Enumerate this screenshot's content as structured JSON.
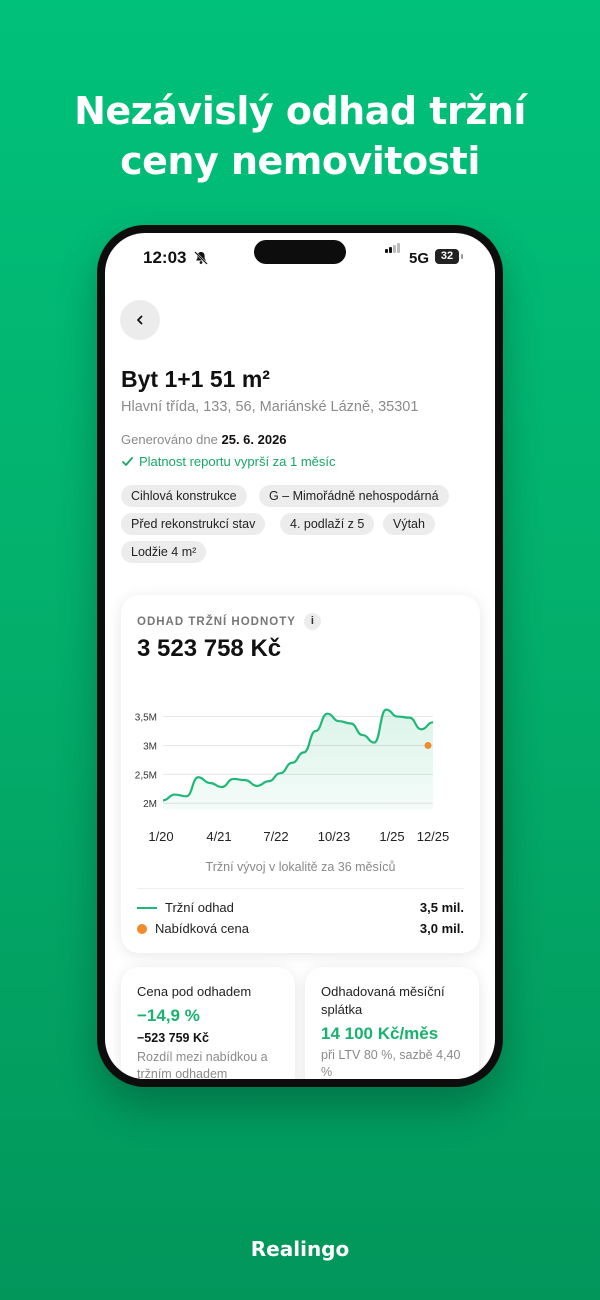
{
  "headline": {
    "line1": "Nezávislý odhad tržní",
    "line2": "ceny nemovitosti"
  },
  "status_bar": {
    "time": "12:03",
    "network": "5G",
    "battery": "32"
  },
  "property": {
    "title": "Byt 1+1 51 m²",
    "address": "Hlavní třída, 133, 56, Mariánské Lázně, 35301",
    "generated_label": "Generováno dne",
    "generated_date": "25. 6. 2026",
    "validity": "Platnost reportu vyprší za 1 měsíc"
  },
  "chips": [
    "Cihlová konstrukce",
    "G – Mimořádně nehospodárná",
    "Před rekonstrukcí stav",
    "4. podlaží z 5",
    "Výtah",
    "Lodžie 4 m²"
  ],
  "estimate_card": {
    "label": "ODHAD TRŽNÍ HODNOTY",
    "info": "i",
    "value": "3 523 758 Kč",
    "caption": "Tržní vývoj v lokalitě za 36 měsíců",
    "legend": [
      {
        "label": "Tržní odhad",
        "value": "3,5 mil."
      },
      {
        "label": "Nabídková cena",
        "value": "3,0 mil."
      }
    ]
  },
  "chart_data": {
    "type": "line",
    "x_ticks": [
      "1/20",
      "4/21",
      "7/22",
      "10/23",
      "1/25",
      "12/25"
    ],
    "y_ticks": [
      "2M",
      "2,5M",
      "3M",
      "3,5M"
    ],
    "ylim": [
      2.0,
      3.5
    ],
    "grid": true,
    "series": [
      {
        "name": "Tržní odhad",
        "color": "#20b879",
        "values": [
          2.05,
          2.15,
          2.12,
          2.45,
          2.35,
          2.28,
          2.42,
          2.4,
          2.3,
          2.38,
          2.52,
          2.7,
          2.88,
          3.25,
          3.55,
          3.42,
          3.38,
          3.18,
          3.05,
          3.62,
          3.5,
          3.48,
          3.28,
          3.4
        ]
      },
      {
        "name": "Nabídková cena",
        "color": "#f08a2b",
        "values": [
          3.0
        ]
      }
    ]
  },
  "price_card": {
    "label": "Cena pod odhadem",
    "value": "−14,9 %",
    "sub": "−523 759 Kč",
    "note": "Rozdíl mezi nabídkou a tržním odhadem"
  },
  "payment_card": {
    "label": "Odhadovaná měsíční splátka",
    "value": "14 100 Kč/měs",
    "note": "při LTV 80 %, sazbě 4,40 %"
  },
  "brand": "Realingo"
}
